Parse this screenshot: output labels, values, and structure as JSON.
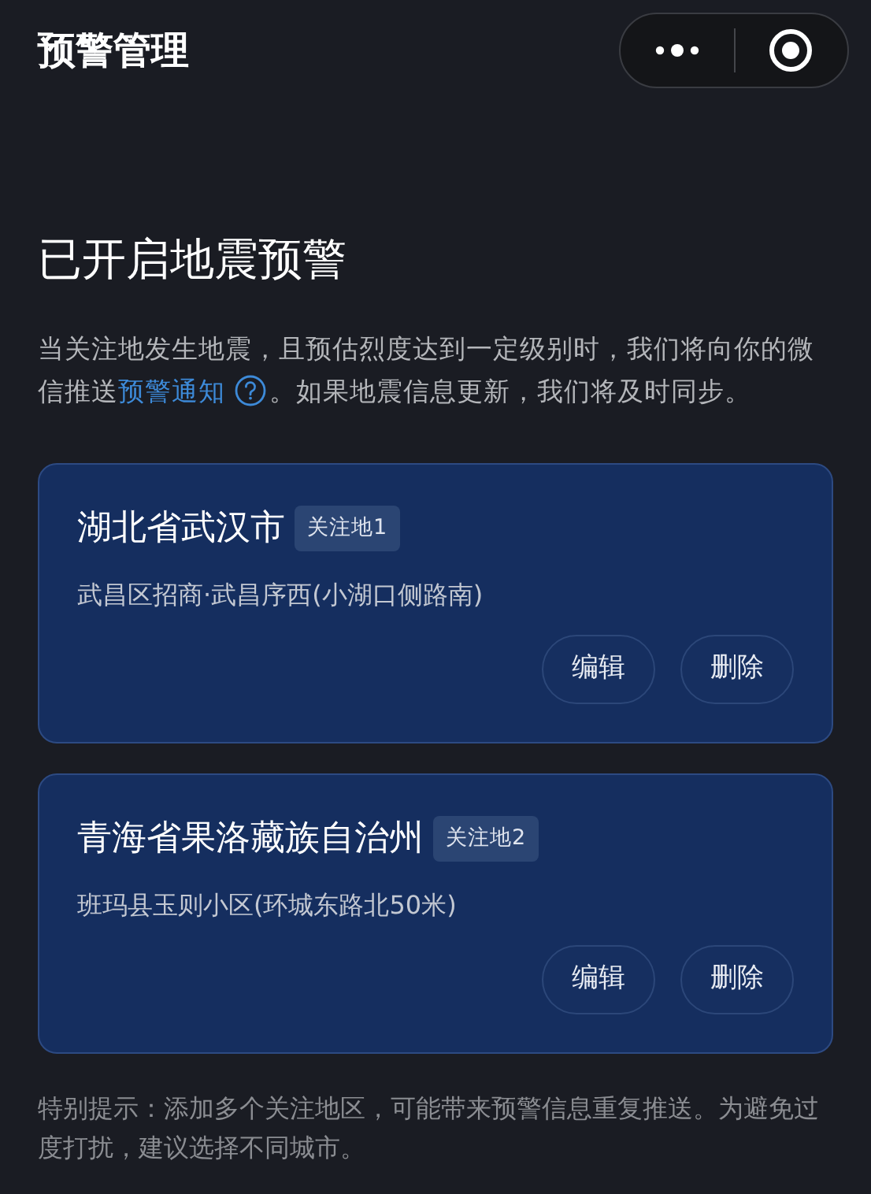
{
  "nav_bar": {
    "title": "预警管理"
  },
  "heading": "已开启地震预警",
  "description": {
    "before": "当关注地发生地震，且预估烈度达到一定级别时，我们将向你的微信推送",
    "link": "预警通知",
    "after": "。如果地震信息更新，我们将及时同步。"
  },
  "locations": [
    {
      "name": "湖北省武汉市",
      "tag": "关注地1",
      "address": "武昌区招商·武昌序西(小湖口侧路南)",
      "buttons": [
        "编辑",
        "删除"
      ]
    },
    {
      "name": "青海省果洛藏族自治州",
      "tag": "关注地2",
      "address": "班玛县玉则小区(环城东路北50米)",
      "buttons": [
        "编辑",
        "删除"
      ]
    }
  ],
  "footer_note": "特别提示：添加多个关注地区，可能带来预警信息重复推送。为避免过度打扰，建议选择不同城市。"
}
